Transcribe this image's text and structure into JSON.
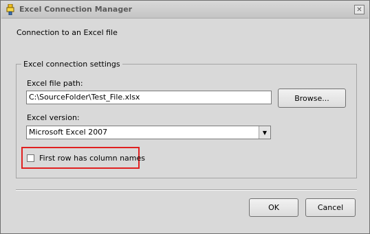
{
  "window": {
    "title": "Excel Connection Manager",
    "close_glyph": "✕",
    "icon": "excel-connection-icon"
  },
  "subtitle": "Connection to an Excel file",
  "settings": {
    "legend": "Excel connection settings",
    "file_path_label": "Excel file path:",
    "file_path_value": "C:\\SourceFolder\\Test_File.xlsx",
    "browse_label": "Browse...",
    "version_label": "Excel version:",
    "version_value": "Microsoft Excel 2007",
    "version_arrow": "▼",
    "first_row_label": "First row has column names",
    "first_row_checked": false
  },
  "footer": {
    "ok_label": "OK",
    "cancel_label": "Cancel"
  },
  "colors": {
    "highlight": "#e02020",
    "window_bg": "#d9d9d9"
  }
}
